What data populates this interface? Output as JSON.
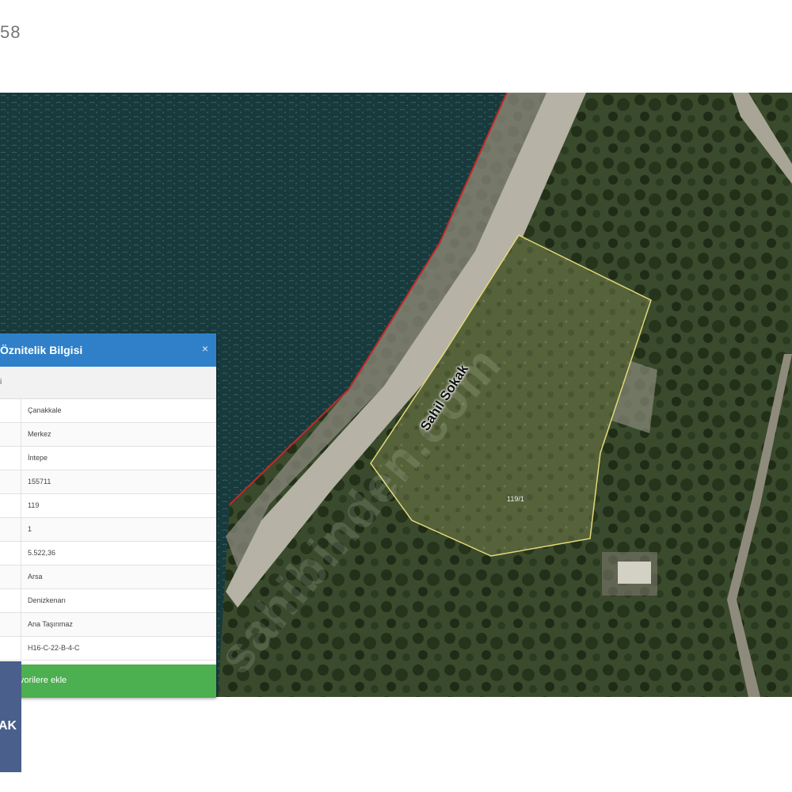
{
  "header": {
    "listing_id_fragment": "58"
  },
  "map": {
    "street_label": "Sahil Sokak",
    "parcel_label": "119/1",
    "watermark": "sahibinden.com",
    "colors": {
      "parcel_outline": "#e3d97a",
      "coastline": "#c62828",
      "sea": "#183a3d"
    }
  },
  "panel": {
    "title": "Öznitelik Bilgisi",
    "close_label": "×",
    "subheader": "i",
    "rows": [
      {
        "value": "Çanakkale"
      },
      {
        "value": "Merkez"
      },
      {
        "value": "İntepe"
      },
      {
        "value": "155711"
      },
      {
        "value": "119"
      },
      {
        "value": "1"
      },
      {
        "value": "5.522,36"
      },
      {
        "value": "Arsa"
      },
      {
        "value": "Denizkenarı"
      },
      {
        "value": "Ana Taşınmaz"
      },
      {
        "value": "H16-C-22-B-4-C"
      }
    ],
    "favorite_label": "Favorilere ekle"
  },
  "side_tab": {
    "label": "AK"
  },
  "colors": {
    "panel_header": "#2f80c9",
    "favorite_bar": "#4caf50",
    "side_tab": "#4a5f8c"
  }
}
